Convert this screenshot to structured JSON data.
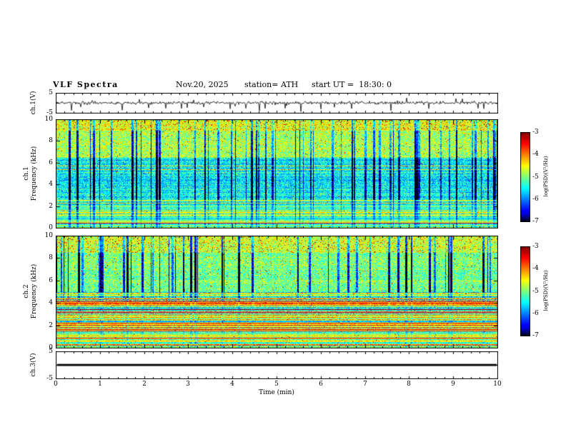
{
  "header": {
    "title": "VLF Spectra",
    "date": "Nov.20, 2025",
    "station": "station= ATH",
    "start_ut": "start UT =  18:30: 0"
  },
  "xaxis": {
    "label": "Time (min)",
    "min": 0,
    "max": 10,
    "ticks": [
      0,
      1,
      2,
      3,
      4,
      5,
      6,
      7,
      8,
      9,
      10
    ]
  },
  "panels": {
    "ch1_wave": {
      "ylabel": "ch.1(V)",
      "ymin": -5,
      "ymax": 5,
      "yticks": [
        5,
        -5
      ]
    },
    "ch1_spec": {
      "label_channel": "ch.1",
      "label_axis": "Frequency (kHz)",
      "ymin": 0,
      "ymax": 10,
      "yticks": [
        10,
        8,
        6,
        4,
        2,
        0
      ]
    },
    "ch2_spec": {
      "label_channel": "ch.2",
      "label_axis": "Frequency (kHz)",
      "ymin": 0,
      "ymax": 10,
      "yticks": [
        10,
        8,
        6,
        4,
        2,
        0
      ]
    },
    "ch3_wave": {
      "ylabel": "ch.3(V)",
      "ymin": -5,
      "ymax": 5,
      "yticks": [
        5,
        -5
      ]
    }
  },
  "colorbars": [
    {
      "label": "log(PSD)(V²/Hz)",
      "ticks": [
        -3,
        -4,
        -5,
        -6,
        -7
      ],
      "zmin": -7,
      "zmax": -3,
      "colormap": "jet"
    },
    {
      "label": "log(PSD)(V²/Hz)",
      "ticks": [
        -3,
        -4,
        -5,
        -6,
        -7
      ],
      "zmin": -7,
      "zmax": -3,
      "colormap": "jet"
    }
  ],
  "chart_data": [
    {
      "id": "ch1_wave",
      "type": "line",
      "ylabel": "ch.1(V)",
      "ylim": [
        -5,
        5
      ],
      "xlim": [
        0,
        10
      ],
      "description": "continuous broadband noise around 0 V with dense impulsive sferic spikes, mostly downward to about -4 V",
      "noise_amp": 0.9,
      "neg_spike_prob": 0.035,
      "neg_spike_amp": 3.2,
      "pos_spike_prob": 0.012,
      "pos_spike_amp": 1.8,
      "seed": 11
    },
    {
      "id": "ch1_spec",
      "type": "heatmap",
      "ylabel": "ch.1 Frequency (kHz)",
      "xlim": [
        0,
        10
      ],
      "ylim": [
        0,
        10
      ],
      "zlabel": "log(PSD)(V²/Hz)",
      "zlim": [
        -7,
        -3
      ],
      "colormap": "jet",
      "description": "VLF spectrogram: green/yellow broadband power with red flecks above ~7 kHz, blue quieter band 2.5-6.5 kHz cut by dark-blue vertical sferic streaks, horizontally banded cyan/blue power below 2.5 kHz",
      "streak_prob": 0.085,
      "seed": 22,
      "bands": [
        {
          "f_min": 9.0,
          "f_max": 10.0,
          "base": 0.62,
          "noise": 0.26,
          "streak_w": 0.5,
          "speckle": 0.05,
          "hband": 0.03,
          "bright_row_prob": 0.0,
          "red_row_prob": 0.0
        },
        {
          "f_min": 6.5,
          "f_max": 9.0,
          "base": 0.56,
          "noise": 0.26,
          "streak_w": 0.75,
          "speckle": 0.015,
          "hband": 0.03,
          "bright_row_prob": 0.0,
          "red_row_prob": 0.0
        },
        {
          "f_min": 2.6,
          "f_max": 6.5,
          "base": 0.4,
          "noise": 0.26,
          "streak_w": 0.95,
          "speckle": 0.006,
          "hband": 0.07,
          "bright_row_prob": 0.03,
          "red_row_prob": 0.0
        },
        {
          "f_min": 1.0,
          "f_max": 2.6,
          "base": 0.46,
          "noise": 0.2,
          "streak_w": 0.5,
          "speckle": 0.004,
          "hband": 0.14,
          "bright_row_prob": 0.06,
          "red_row_prob": 0.01
        },
        {
          "f_min": 0.0,
          "f_max": 1.0,
          "base": 0.42,
          "noise": 0.16,
          "streak_w": 0.3,
          "speckle": 0.003,
          "hband": 0.2,
          "bright_row_prob": 0.08,
          "red_row_prob": 0.01
        }
      ]
    },
    {
      "id": "ch2_spec",
      "type": "heatmap",
      "ylabel": "ch.2 Frequency (kHz)",
      "xlim": [
        0,
        10
      ],
      "ylim": [
        0,
        10
      ],
      "zlabel": "log(PSD)(V²/Hz)",
      "zlim": [
        -7,
        -3
      ],
      "colormap": "jet",
      "description": "VLF spectrogram: green/yellow power with dark-blue vertical sferic streaks above ~5 kHz, strong horizontal green/yellow/red banding (power-line harmonics) below ~5 kHz",
      "streak_prob": 0.085,
      "seed": 33,
      "bands": [
        {
          "f_min": 8.5,
          "f_max": 10.0,
          "base": 0.6,
          "noise": 0.26,
          "streak_w": 0.6,
          "speckle": 0.05,
          "hband": 0.03,
          "bright_row_prob": 0.0,
          "red_row_prob": 0.0
        },
        {
          "f_min": 5.0,
          "f_max": 8.5,
          "base": 0.52,
          "noise": 0.26,
          "streak_w": 0.9,
          "speckle": 0.012,
          "hband": 0.04,
          "bright_row_prob": 0.0,
          "red_row_prob": 0.0
        },
        {
          "f_min": 4.2,
          "f_max": 5.0,
          "base": 0.56,
          "noise": 0.2,
          "streak_w": 0.4,
          "speckle": 0.02,
          "hband": 0.25,
          "bright_row_prob": 0.15,
          "red_row_prob": 0.05
        },
        {
          "f_min": 0.0,
          "f_max": 4.2,
          "base": 0.55,
          "noise": 0.18,
          "streak_w": 0.15,
          "speckle": 0.008,
          "hband": 0.26,
          "bright_row_prob": 0.14,
          "red_row_prob": 0.035
        }
      ]
    },
    {
      "id": "ch3_wave",
      "type": "line",
      "ylabel": "ch.3(V)",
      "ylim": [
        -5,
        5
      ],
      "xlim": [
        0,
        10
      ],
      "description": "flat trace at 0 V (channel has no signal)",
      "seed": 44
    }
  ]
}
